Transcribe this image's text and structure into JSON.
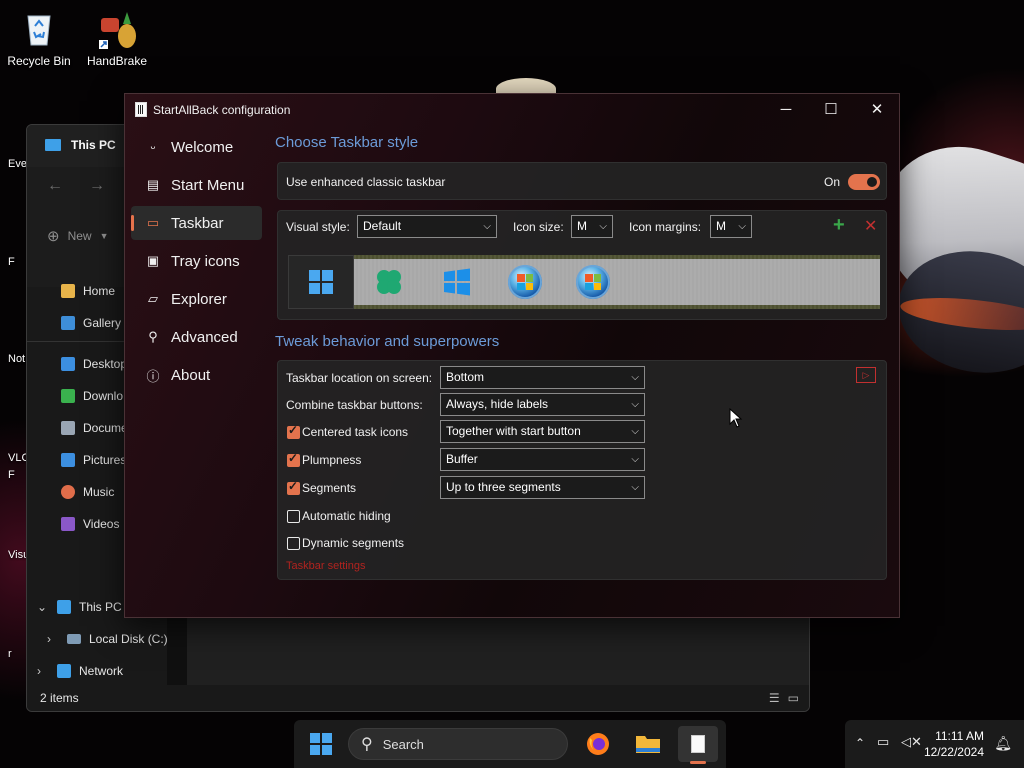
{
  "desktop": {
    "icons": [
      {
        "label": "Recycle Bin",
        "icon": "recycle-bin-icon"
      },
      {
        "label": "HandBrake",
        "icon": "handbrake-icon"
      }
    ],
    "edge_labels": [
      "Eve",
      "F",
      "Not",
      "VLC",
      "F",
      "Visu",
      "r"
    ]
  },
  "explorer": {
    "title": "This PC",
    "new_label": "New",
    "quick": [
      {
        "label": "Home",
        "color": "#e8b44a"
      },
      {
        "label": "Gallery",
        "color": "#3e8ed8"
      }
    ],
    "folders": [
      {
        "label": "Desktop",
        "color": "#3c8fe0"
      },
      {
        "label": "Downlo",
        "color": "#3ab24e"
      },
      {
        "label": "Docume",
        "color": "#9aa6b4"
      },
      {
        "label": "Pictures",
        "color": "#3c8fe0"
      },
      {
        "label": "Music",
        "color": "#e06d4a"
      },
      {
        "label": "Videos",
        "color": "#8a58c8"
      }
    ],
    "tree": [
      {
        "label": "This PC",
        "expander": "⌄"
      },
      {
        "label": "Local Disk (C:)",
        "expander": "›"
      },
      {
        "label": "Network",
        "expander": "›"
      }
    ],
    "status": "2 items"
  },
  "sab": {
    "title": "StartAllBack configuration",
    "nav": [
      {
        "label": "Welcome",
        "icon": "smile-icon",
        "glyph": "ᵕ"
      },
      {
        "label": "Start Menu",
        "icon": "start-menu-icon",
        "glyph": "▤"
      },
      {
        "label": "Taskbar",
        "icon": "taskbar-icon",
        "glyph": "▭"
      },
      {
        "label": "Tray icons",
        "icon": "tray-icons-icon",
        "glyph": "▣"
      },
      {
        "label": "Explorer",
        "icon": "explorer-icon",
        "glyph": "▱"
      },
      {
        "label": "Advanced",
        "icon": "wrench-icon",
        "glyph": "⚲"
      },
      {
        "label": "About",
        "icon": "info-icon",
        "glyph": "ⓘ"
      }
    ],
    "active_nav": "Taskbar",
    "section1": "Choose Taskbar style",
    "enhanced_label": "Use enhanced classic taskbar",
    "enhanced_state": "On",
    "visual_style_label": "Visual style:",
    "visual_style": "Default",
    "icon_size_label": "Icon size:",
    "icon_size": "M",
    "icon_margins_label": "Icon margins:",
    "icon_margins": "M",
    "section2": "Tweak behavior and superpowers",
    "rows": [
      {
        "label": "Taskbar location on screen:",
        "value": "Bottom",
        "checkbox": null
      },
      {
        "label": "Combine taskbar buttons:",
        "value": "Always, hide labels",
        "checkbox": null
      },
      {
        "label": "Centered task icons",
        "value": "Together with start button",
        "checkbox": true
      },
      {
        "label": "Plumpness",
        "value": "Buffer",
        "checkbox": true
      },
      {
        "label": "Segments",
        "value": "Up to three segments",
        "checkbox": true
      },
      {
        "label": "Automatic hiding",
        "value": null,
        "checkbox": false
      },
      {
        "label": "Dynamic segments",
        "value": null,
        "checkbox": false
      }
    ],
    "footer_link": "Taskbar settings"
  },
  "taskbar": {
    "search": "Search",
    "time": "11:11 AM",
    "date": "12/22/2024"
  },
  "colors": {
    "accent": "#e3734d",
    "heading": "#6c9bd8"
  }
}
